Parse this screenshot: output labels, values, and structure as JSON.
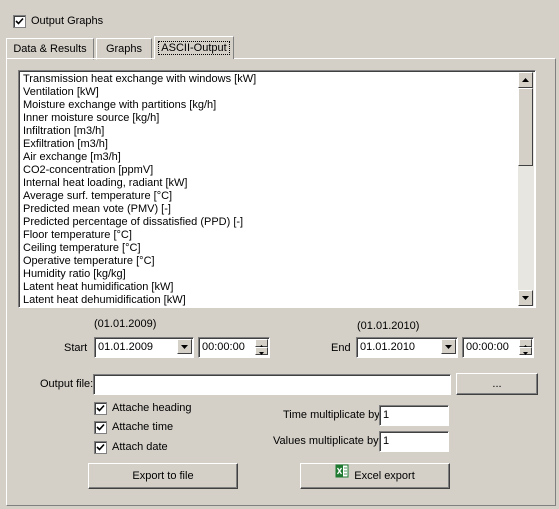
{
  "header": {
    "output_graphs_label": "Output Graphs",
    "output_graphs_checked": true
  },
  "tabs": [
    {
      "label": "Data & Results",
      "active": false
    },
    {
      "label": "Graphs",
      "active": false
    },
    {
      "label": "ASCII-Output",
      "active": true
    }
  ],
  "variables": [
    "Transmission heat exchange with windows [kW]",
    "Ventilation [kW]",
    "Moisture exchange with partitions [kg/h]",
    "Inner moisture source [kg/h]",
    "Infiltration [m3/h]",
    "Exfiltration [m3/h]",
    "Air exchange [m3/h]",
    "CO2-concentration [ppmV]",
    "Internal heat loading, radiant [kW]",
    "Average surf. temperature [°C]",
    "Predicted mean vote (PMV) [-]",
    "Predicted percentage of dissatisfied (PPD) [-]",
    "Floor temperature [°C]",
    "Ceiling temperature [°C]",
    "Operative temperature [°C]",
    "Humidity ratio [kg/kg]",
    "Latent heat humidification [kW]",
    "Latent heat dehumidification [kW]"
  ],
  "range": {
    "start_label": "Start",
    "start_hint": "(01.01.2009)",
    "start_date": "01.01.2009",
    "start_time": "00:00:00",
    "end_label": "End",
    "end_hint": "(01.01.2010)",
    "end_date": "01.01.2010",
    "end_time": "00:00:00"
  },
  "output": {
    "file_label": "Output file:",
    "file_value": "",
    "browse_label": "..."
  },
  "options": {
    "attach_heading": "Attache heading",
    "attach_time": "Attache time",
    "attach_date": "Attach date",
    "time_mult_label": "Time multiplicate by",
    "time_mult_value": "1",
    "values_mult_label": "Values multiplicate by",
    "values_mult_value": "1"
  },
  "buttons": {
    "export_file": "Export to file",
    "excel_export": "Excel export"
  }
}
